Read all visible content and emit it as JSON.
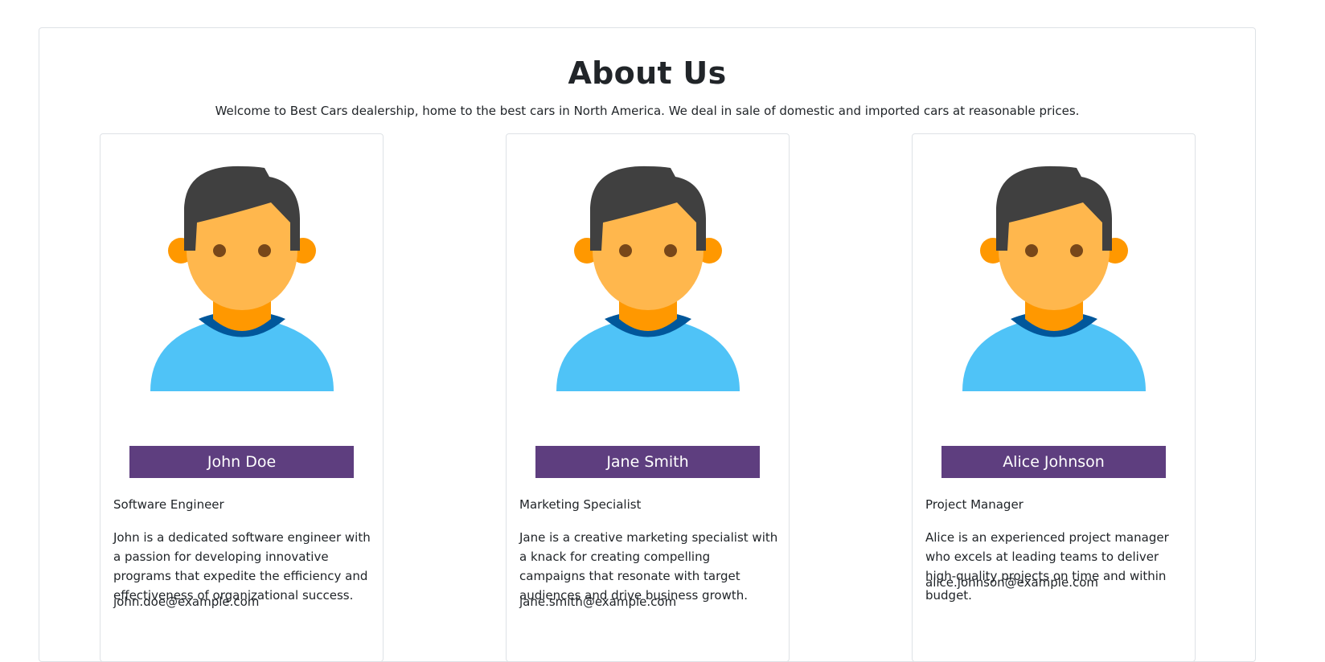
{
  "header": {
    "title": "About Us",
    "subtitle": "Welcome to Best Cars dealership, home to the best cars in North America. We deal in sale of domestic and imported cars at reasonable prices."
  },
  "team": [
    {
      "name": "John Doe",
      "role": "Software Engineer",
      "bio": "John is a dedicated software engineer with a passion for developing innovative programs that expedite the efficiency and effectiveness of organizational success.",
      "email": "john.doe@example.com"
    },
    {
      "name": "Jane Smith",
      "role": "Marketing Specialist",
      "bio": "Jane is a creative marketing specialist with a knack for creating compelling campaigns that resonate with target audiences and drive business growth.",
      "email": "jane.smith@example.com"
    },
    {
      "name": "Alice Johnson",
      "role": "Project Manager",
      "bio": "Alice is an experienced project manager who excels at leading teams to deliver high-quality projects on time and within budget.",
      "email": "alice.johnson@example.com"
    }
  ],
  "icons": {
    "avatar": "person-avatar-icon"
  },
  "colors": {
    "name_bar": "#5e3e7f",
    "hair": "#404040",
    "skin": "#ffb74d",
    "neck": "#ff9800",
    "shirt": "#4fc3f7",
    "collar": "#01579b"
  }
}
